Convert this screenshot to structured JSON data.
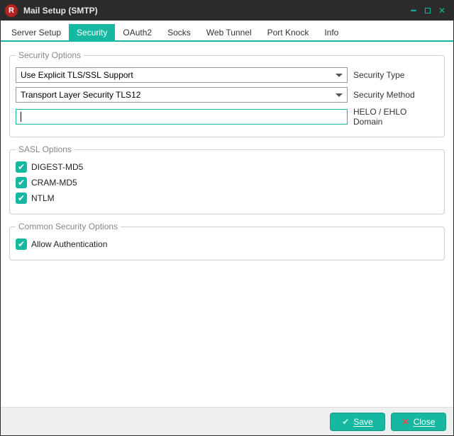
{
  "window": {
    "title": "Mail Setup (SMTP)"
  },
  "tabs": [
    {
      "label": "Server Setup"
    },
    {
      "label": "Security"
    },
    {
      "label": "OAuth2"
    },
    {
      "label": "Socks"
    },
    {
      "label": "Web Tunnel"
    },
    {
      "label": "Port Knock"
    },
    {
      "label": "Info"
    }
  ],
  "security_options": {
    "legend": "Security Options",
    "security_type": {
      "value": "Use Explicit TLS/SSL Support",
      "label": "Security Type"
    },
    "security_method": {
      "value": "Transport Layer Security TLS12",
      "label": "Security Method"
    },
    "helo_domain": {
      "value": "",
      "label": "HELO / EHLO Domain"
    }
  },
  "sasl_options": {
    "legend": "SASL Options",
    "items": [
      {
        "label": "DIGEST-MD5",
        "checked": true
      },
      {
        "label": "CRAM-MD5",
        "checked": true
      },
      {
        "label": "NTLM",
        "checked": true
      }
    ]
  },
  "common_security_options": {
    "legend": "Common Security Options",
    "allow_auth": {
      "label": "Allow Authentication",
      "checked": true
    }
  },
  "footer": {
    "save": "Save",
    "close": "Close"
  }
}
